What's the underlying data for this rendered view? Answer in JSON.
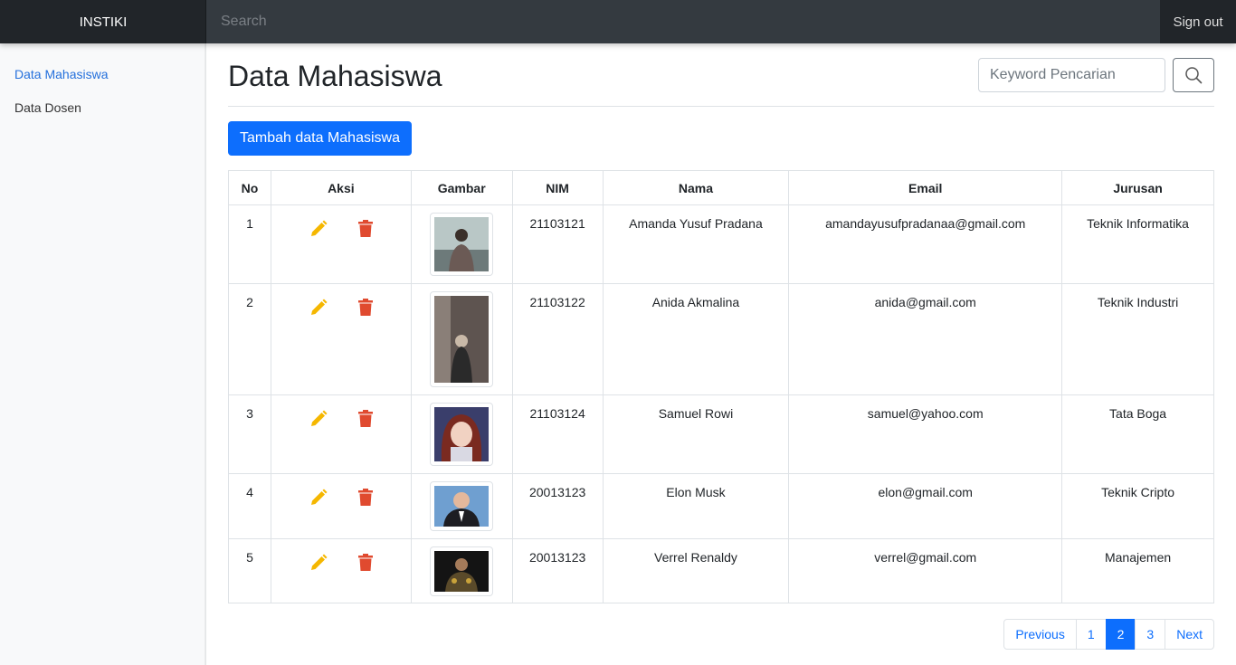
{
  "topbar": {
    "brand": "INSTIKI",
    "search_placeholder": "Search",
    "signout_label": "Sign out"
  },
  "sidebar": {
    "items": [
      {
        "label": "Data Mahasiswa",
        "active": true
      },
      {
        "label": "Data Dosen",
        "active": false
      }
    ]
  },
  "main": {
    "title": "Data Mahasiswa",
    "keyword_placeholder": "Keyword Pencarian",
    "add_button": "Tambah data Mahasiswa"
  },
  "table": {
    "headers": [
      "No",
      "Aksi",
      "Gambar",
      "NIM",
      "Nama",
      "Email",
      "Jurusan"
    ],
    "rows": [
      {
        "no": "1",
        "nim": "21103121",
        "nama": "Amanda Yusuf Pradana",
        "email": "amandayusufpradanaa@gmail.com",
        "jurusan": "Teknik Informatika"
      },
      {
        "no": "2",
        "nim": "21103122",
        "nama": "Anida Akmalina",
        "email": "anida@gmail.com",
        "jurusan": "Teknik Industri"
      },
      {
        "no": "3",
        "nim": "21103124",
        "nama": "Samuel Rowi",
        "email": "samuel@yahoo.com",
        "jurusan": "Tata Boga"
      },
      {
        "no": "4",
        "nim": "20013123",
        "nama": "Elon Musk",
        "email": "elon@gmail.com",
        "jurusan": "Teknik Cripto"
      },
      {
        "no": "5",
        "nim": "20013123",
        "nama": "Verrel Renaldy",
        "email": "verrel@gmail.com",
        "jurusan": "Manajemen"
      }
    ]
  },
  "icons": {
    "edit": "pencil-icon",
    "delete": "trash-icon",
    "search": "search-icon"
  },
  "colors": {
    "primary": "#0d6efd",
    "edit_icon": "#f5b700",
    "delete_icon": "#e04a2f",
    "topbar": "#343a40"
  },
  "pagination": {
    "previous": "Previous",
    "pages": [
      "1",
      "2",
      "3"
    ],
    "active_page": "2",
    "next": "Next"
  }
}
